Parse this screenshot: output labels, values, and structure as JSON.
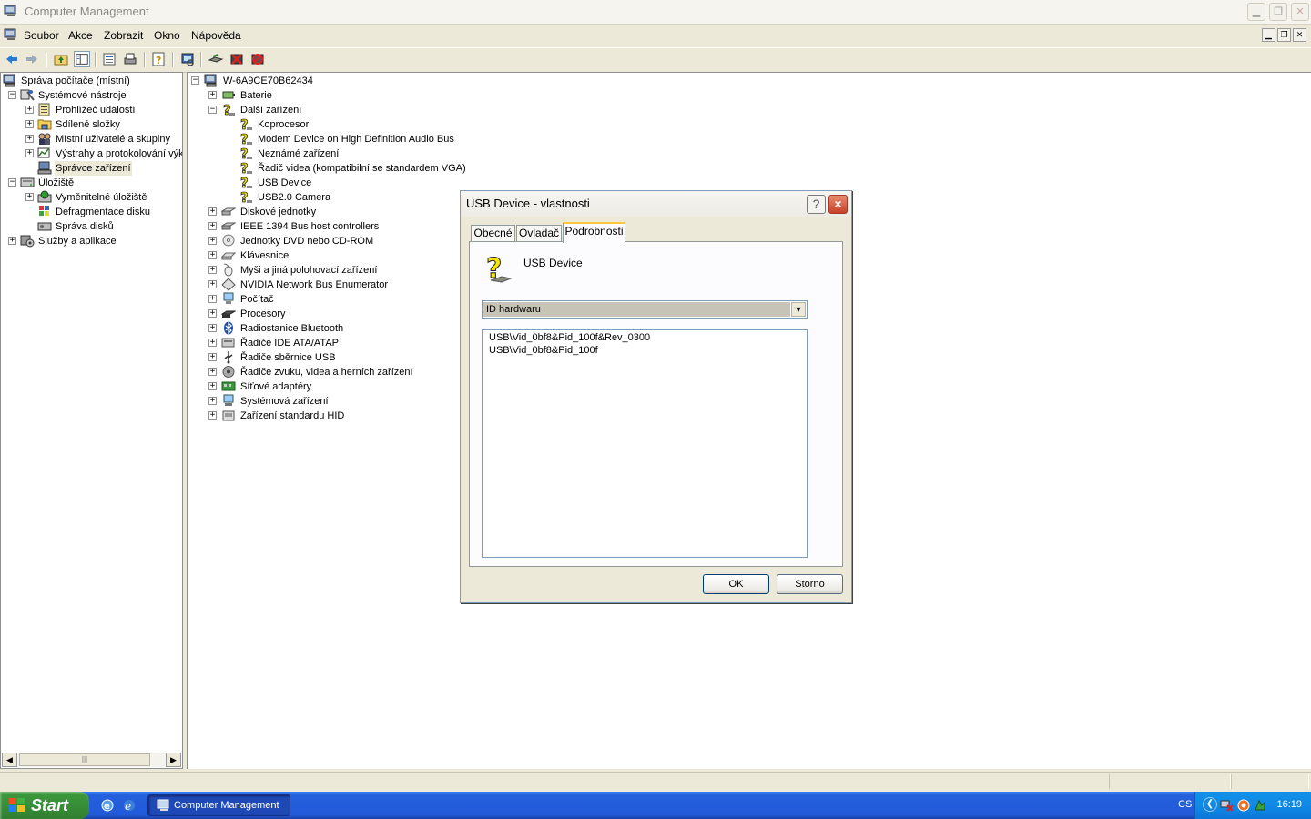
{
  "window": {
    "title": "Computer Management"
  },
  "menu": {
    "items": [
      "Soubor",
      "Akce",
      "Zobrazit",
      "Okno",
      "Nápověda"
    ]
  },
  "left_tree": [
    {
      "label": "Správa počítače (místní)"
    },
    {
      "label": "Systémové nástroje"
    },
    {
      "label": "Prohlížeč událostí"
    },
    {
      "label": "Sdílené složky"
    },
    {
      "label": "Místní uživatelé a skupiny"
    },
    {
      "label": "Výstrahy a protokolování výk"
    },
    {
      "label": "Správce zařízení"
    },
    {
      "label": "Úložiště"
    },
    {
      "label": "Vyměnitelné úložiště"
    },
    {
      "label": "Defragmentace disku"
    },
    {
      "label": "Správa disků"
    },
    {
      "label": "Služby a aplikace"
    }
  ],
  "device_tree": {
    "root": "W-6A9CE70B62434",
    "items": [
      {
        "label": "Baterie"
      },
      {
        "label": "Další zařízení"
      },
      {
        "label": "Koprocesor"
      },
      {
        "label": "Modem Device on High Definition Audio Bus"
      },
      {
        "label": "Neznámé zařízení"
      },
      {
        "label": "Řadič videa (kompatibilní se standardem VGA)"
      },
      {
        "label": "USB Device"
      },
      {
        "label": "USB2.0 Camera"
      },
      {
        "label": "Diskové jednotky"
      },
      {
        "label": "IEEE 1394 Bus host controllers"
      },
      {
        "label": "Jednotky DVD nebo CD-ROM"
      },
      {
        "label": "Klávesnice"
      },
      {
        "label": "Myši a jiná polohovací zařízení"
      },
      {
        "label": "NVIDIA Network Bus Enumerator"
      },
      {
        "label": "Počítač"
      },
      {
        "label": "Procesory"
      },
      {
        "label": "Radiostanice Bluetooth"
      },
      {
        "label": "Řadiče IDE ATA/ATAPI"
      },
      {
        "label": "Řadiče sběrnice USB"
      },
      {
        "label": "Řadiče zvuku, videa a herních zařízení"
      },
      {
        "label": "Síťové adaptéry"
      },
      {
        "label": "Systémová zařízení"
      },
      {
        "label": "Zařízení standardu HID"
      }
    ]
  },
  "dialog": {
    "title": "USB Device - vlastnosti",
    "help": "?",
    "close": "×",
    "tabs": [
      {
        "label": "Obecné"
      },
      {
        "label": "Ovladač"
      },
      {
        "label": "Podrobnosti"
      }
    ],
    "active_tab": "Podrobnosti",
    "device_name": "USB Device",
    "property_select": "ID hardwaru",
    "values": [
      "USB\\Vid_0bf8&Pid_100f&Rev_0300",
      "USB\\Vid_0bf8&Pid_100f"
    ],
    "ok": "OK",
    "cancel": "Storno"
  },
  "taskbar": {
    "start": "Start",
    "task": "Computer Management",
    "lang": "CS",
    "clock": "16:19"
  },
  "colors": {
    "taskbar": "#225ada",
    "start": "#388e38",
    "tray": "#0f8ae6",
    "warning": "#f5e500"
  }
}
